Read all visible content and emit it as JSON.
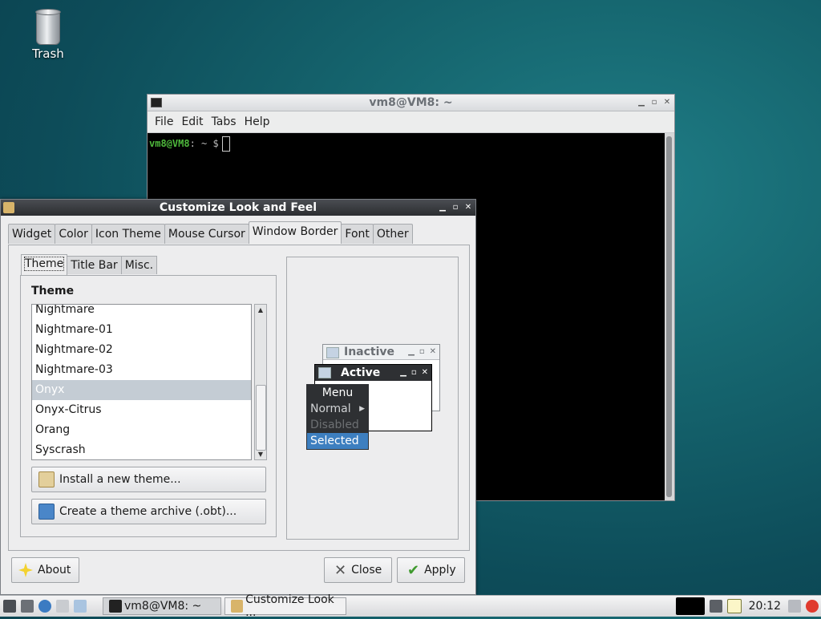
{
  "desktop": {
    "trash_label": "Trash"
  },
  "terminal": {
    "title": "vm8@VM8: ~",
    "menu": [
      "File",
      "Edit",
      "Tabs",
      "Help"
    ],
    "prompt_user": "vm8@VM8",
    "prompt_rest": ": ~ $"
  },
  "dialog": {
    "title": "Customize Look and Feel",
    "tabs": [
      "Widget",
      "Color",
      "Icon Theme",
      "Mouse Cursor",
      "Window Border",
      "Font",
      "Other"
    ],
    "subtabs": [
      "Theme",
      "Title Bar",
      "Misc."
    ],
    "section_title": "Theme",
    "themes": [
      "Nightmare",
      "Nightmare-01",
      "Nightmare-02",
      "Nightmare-03",
      "Onyx",
      "Onyx-Citrus",
      "Orang",
      "Syscrash"
    ],
    "selected_theme": "Onyx",
    "install_button": "Install a new theme...",
    "archive_button": "Create a theme archive (.obt)...",
    "about_button": "About",
    "close_button": "Close",
    "apply_button": "Apply",
    "preview": {
      "inactive_title": "Inactive",
      "active_title": "Active",
      "menu_title": "Menu",
      "item_normal": "Normal",
      "item_disabled": "Disabled",
      "item_selected": "Selected"
    }
  },
  "taskbar": {
    "task1": "vm8@VM8: ~",
    "task2": "Customize Look ...",
    "clock": "20:12"
  }
}
